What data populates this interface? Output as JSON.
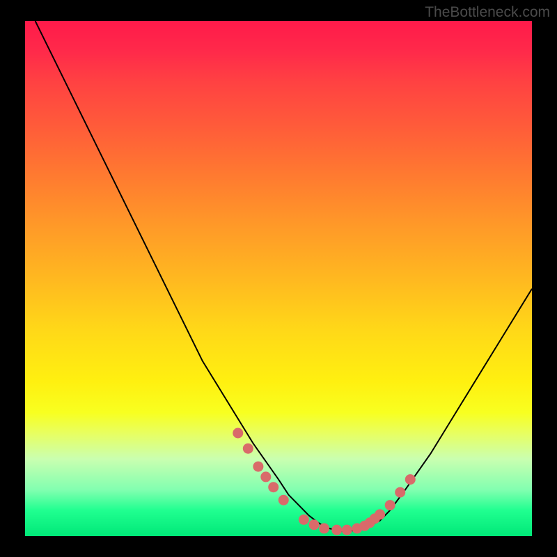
{
  "watermark": "TheBottleneck.com",
  "chart_data": {
    "type": "line",
    "title": "",
    "xlabel": "",
    "ylabel": "",
    "xlim": [
      0,
      100
    ],
    "ylim": [
      0,
      100
    ],
    "series": [
      {
        "name": "curve",
        "x": [
          2,
          5,
          10,
          15,
          20,
          25,
          30,
          35,
          40,
          45,
          50,
          52,
          54,
          56,
          58,
          60,
          62,
          64,
          66,
          68,
          70,
          72,
          75,
          80,
          85,
          90,
          95,
          100
        ],
        "y": [
          100,
          94,
          84,
          74,
          64,
          54,
          44,
          34,
          26,
          18,
          11,
          8,
          6,
          4,
          2.5,
          1.5,
          1,
          1,
          1.2,
          2,
          3,
          5,
          9,
          16,
          24,
          32,
          40,
          48
        ]
      }
    ],
    "markers": {
      "name": "dots",
      "color": "#d96a6a",
      "x": [
        42,
        44,
        46,
        47.5,
        49,
        51,
        55,
        57,
        59,
        61.5,
        63.5,
        65.5,
        67,
        68,
        69,
        70,
        72,
        74,
        76
      ],
      "y": [
        20,
        17,
        13.5,
        11.5,
        9.5,
        7,
        3.2,
        2.2,
        1.5,
        1.2,
        1.2,
        1.5,
        2,
        2.6,
        3.4,
        4.2,
        6,
        8.5,
        11
      ]
    }
  }
}
